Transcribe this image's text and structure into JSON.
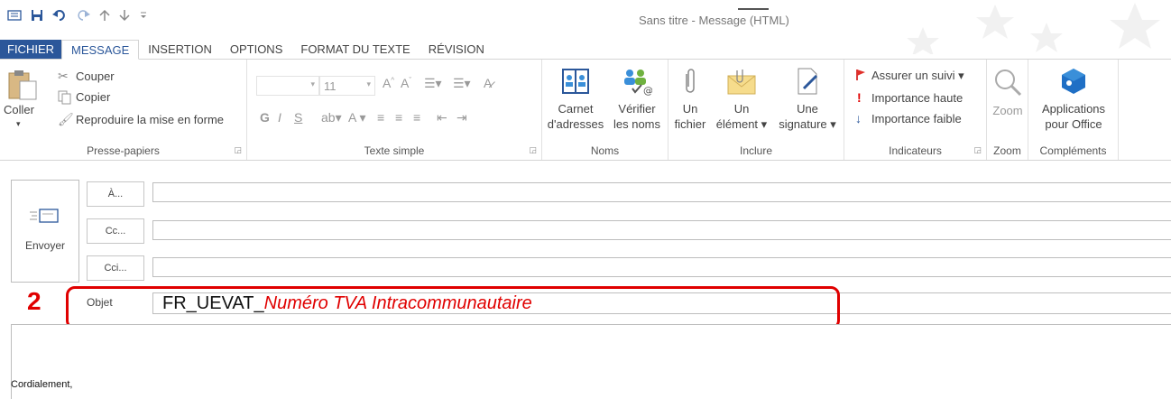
{
  "window": {
    "title": "Sans titre - Message (HTML)"
  },
  "qat": {
    "icons": [
      "envelope-icon",
      "save-icon",
      "undo-icon",
      "redo-icon",
      "up-arrow-icon",
      "down-arrow-icon",
      "customize-icon"
    ]
  },
  "tabs": {
    "file": "FICHIER",
    "message": "MESSAGE",
    "insertion": "INSERTION",
    "options": "OPTIONS",
    "format": "FORMAT DU TEXTE",
    "revision": "RÉVISION"
  },
  "ribbon": {
    "clipboard": {
      "paste": "Coller",
      "cut": "Couper",
      "copy": "Copier",
      "format_painter": "Reproduire la mise en forme",
      "label": "Presse-papiers"
    },
    "basic_text": {
      "font_size": "11",
      "label": "Texte simple"
    },
    "names": {
      "address_book_1": "Carnet",
      "address_book_2": "d'adresses",
      "check_names_1": "Vérifier",
      "check_names_2": "les noms",
      "label": "Noms"
    },
    "include": {
      "attach_file_1": "Un",
      "attach_file_2": "fichier",
      "attach_item_1": "Un",
      "attach_item_2": "élément ▾",
      "signature_1": "Une",
      "signature_2": "signature ▾",
      "label": "Inclure"
    },
    "tags": {
      "follow_up": "Assurer un suivi ▾",
      "high_importance": "Importance haute",
      "low_importance": "Importance faible",
      "label": "Indicateurs"
    },
    "zoom": {
      "zoom": "Zoom",
      "label": "Zoom"
    },
    "addins": {
      "apps_1": "Applications",
      "apps_2": "pour Office",
      "label": "Compléments"
    }
  },
  "compose": {
    "send": "Envoyer",
    "to": "À...",
    "cc": "Cc...",
    "bcc": "Cci...",
    "subject_label": "Objet",
    "subject_prefix": "FR_UEVAT_",
    "subject_highlight": "Numéro TVA Intracommunautaire",
    "step_number": "2",
    "body_text": "Cordialement,"
  },
  "colors": {
    "accent": "#2b579a",
    "annotation": "#e00000"
  }
}
